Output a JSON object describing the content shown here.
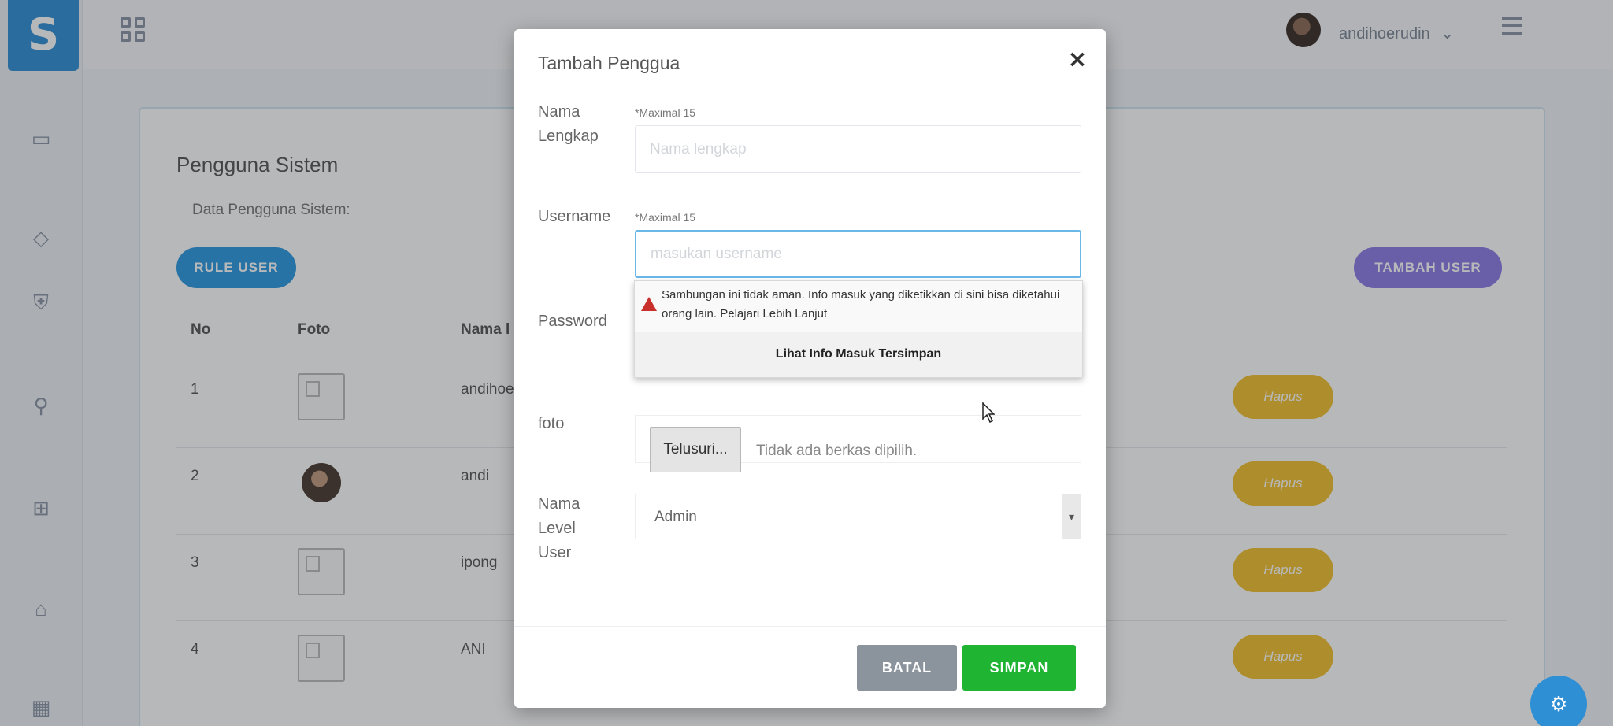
{
  "header": {
    "username": "andihoerudin",
    "dropdown_icon": "⌄"
  },
  "page": {
    "title": "Pengguna Sistem",
    "subtitle": "Data Pengguna Sistem:",
    "rule_user_label": "RULE USER",
    "tambah_user_label": "TAMBAH USER",
    "columns": [
      "No",
      "Foto",
      "Nama l"
    ],
    "rows": [
      {
        "no": "1",
        "name": "andihoe",
        "foto": "placeholder"
      },
      {
        "no": "2",
        "name": "andi",
        "foto": "photo"
      },
      {
        "no": "3",
        "name": "ipong",
        "foto": "placeholder"
      },
      {
        "no": "4",
        "name": "ANI",
        "foto": "placeholder"
      }
    ],
    "hapus_label": "Hapus"
  },
  "modal": {
    "title": "Tambah Penggua",
    "close": "×",
    "nama_label": "Nama Lengkap",
    "nama_hint": "*Maximal 15",
    "nama_placeholder": "Nama lengkap",
    "username_label": "Username",
    "username_hint": "*Maximal 15",
    "username_placeholder": "masukan username",
    "password_label": "Password",
    "autofill_warning": "Sambungan ini tidak aman. Info masuk yang diketikkan di sini bisa diketahui orang lain. Pelajari Lebih Lanjut",
    "autofill_button": "Lihat Info Masuk Tersimpan",
    "foto_label": "foto",
    "file_button": "Telusuri...",
    "file_status": "Tidak ada berkas dipilih.",
    "level_label": "Nama Level User",
    "level_value": "Admin",
    "batal_label": "BATAL",
    "simpan_label": "SIMPAN"
  },
  "colors": {
    "primary": "#2f8fd5",
    "rule_button": "#2b9ae0",
    "tambah_button": "#8c7de6",
    "hapus_button": "#f2c12e",
    "batal_button": "#8b949c",
    "simpan_button": "#1fb432"
  },
  "icons": [
    "logo-s",
    "grid-icon",
    "card-icon",
    "diamond-icon",
    "shield-icon",
    "wrench-icon",
    "basket-icon",
    "bank-icon",
    "apps-icon",
    "menu-icon",
    "warning-icon",
    "chevron-down-icon",
    "close-icon",
    "cursor-icon"
  ]
}
